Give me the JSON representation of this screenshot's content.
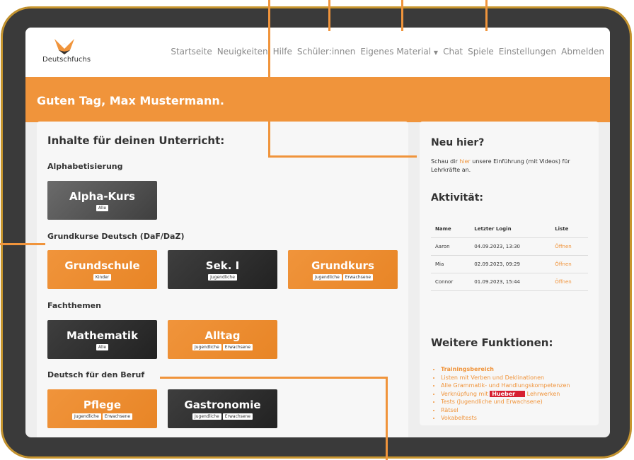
{
  "app": {
    "logo_text": "Deutschfuchs",
    "nav": [
      "Startseite",
      "Neuigkeiten",
      "Hilfe",
      "Schüler:innen",
      "Eigenes Material",
      "Chat",
      "Spiele",
      "Einstellungen",
      "Abmelden"
    ],
    "greeting": "Guten Tag, Max Mustermann."
  },
  "left": {
    "title": "Inhalte für deinen Unterricht:",
    "sections": [
      {
        "label": "Alphabetisierung",
        "tiles": [
          {
            "name": "Alpha-Kurs",
            "tags": [
              "Alle"
            ]
          }
        ]
      },
      {
        "label": "Grundkurse Deutsch (DaF/DaZ)",
        "tiles": [
          {
            "name": "Grundschule",
            "tags": [
              "Kinder"
            ]
          },
          {
            "name": "Sek. I",
            "tags": [
              "Jugendliche"
            ]
          },
          {
            "name": "Grundkurs",
            "tags": [
              "Jugendliche",
              "Erwachsene"
            ]
          }
        ]
      },
      {
        "label": "Fachthemen",
        "tiles": [
          {
            "name": "Mathematik",
            "tags": [
              "Alle"
            ]
          },
          {
            "name": "Alltag",
            "tags": [
              "Jugendliche",
              "Erwachsene"
            ]
          }
        ]
      },
      {
        "label": "Deutsch für den Beruf",
        "tiles": [
          {
            "name": "Pflege",
            "tags": [
              "Jugendliche",
              "Erwachsene"
            ]
          },
          {
            "name": "Gastronomie",
            "tags": [
              "Jugendliche",
              "Erwachsene"
            ]
          }
        ]
      }
    ]
  },
  "right": {
    "intro_title": "Neu hier?",
    "intro_before": "Schau dir ",
    "intro_link": "hier",
    "intro_after": " unsere Einführung (mit Videos) für Lehrkräfte an.",
    "activity_title": "Aktivität:",
    "table_headers": [
      "Name",
      "Letzter Login",
      "Liste"
    ],
    "rows": [
      {
        "name": "Aaron",
        "login": "04.09.2023, 13:30",
        "list": "Öffnen"
      },
      {
        "name": "Mia",
        "login": "02.09.2023, 09:29",
        "list": "Öffnen"
      },
      {
        "name": "Connor",
        "login": "01.09.2023, 15:44",
        "list": "Öffnen"
      }
    ],
    "more_title": "Weitere Funktionen:",
    "more_items": [
      "Trainingsbereich",
      "Listen mit Verben und Deklinationen",
      "Alle Grammatik- und Handlungskompetenzen",
      "Tests (Jugendliche und Erwachsene)",
      "Rätsel",
      "Vokabeltests"
    ],
    "link_before": "Verknüpfung mit ",
    "link_brand": "Hueber",
    "link_after": " Lehrwerken"
  },
  "colors": {
    "accent": "#f0943b",
    "frame": "#3a3a3a",
    "frame_border": "#c8962f",
    "hueber": "#d61f31"
  }
}
